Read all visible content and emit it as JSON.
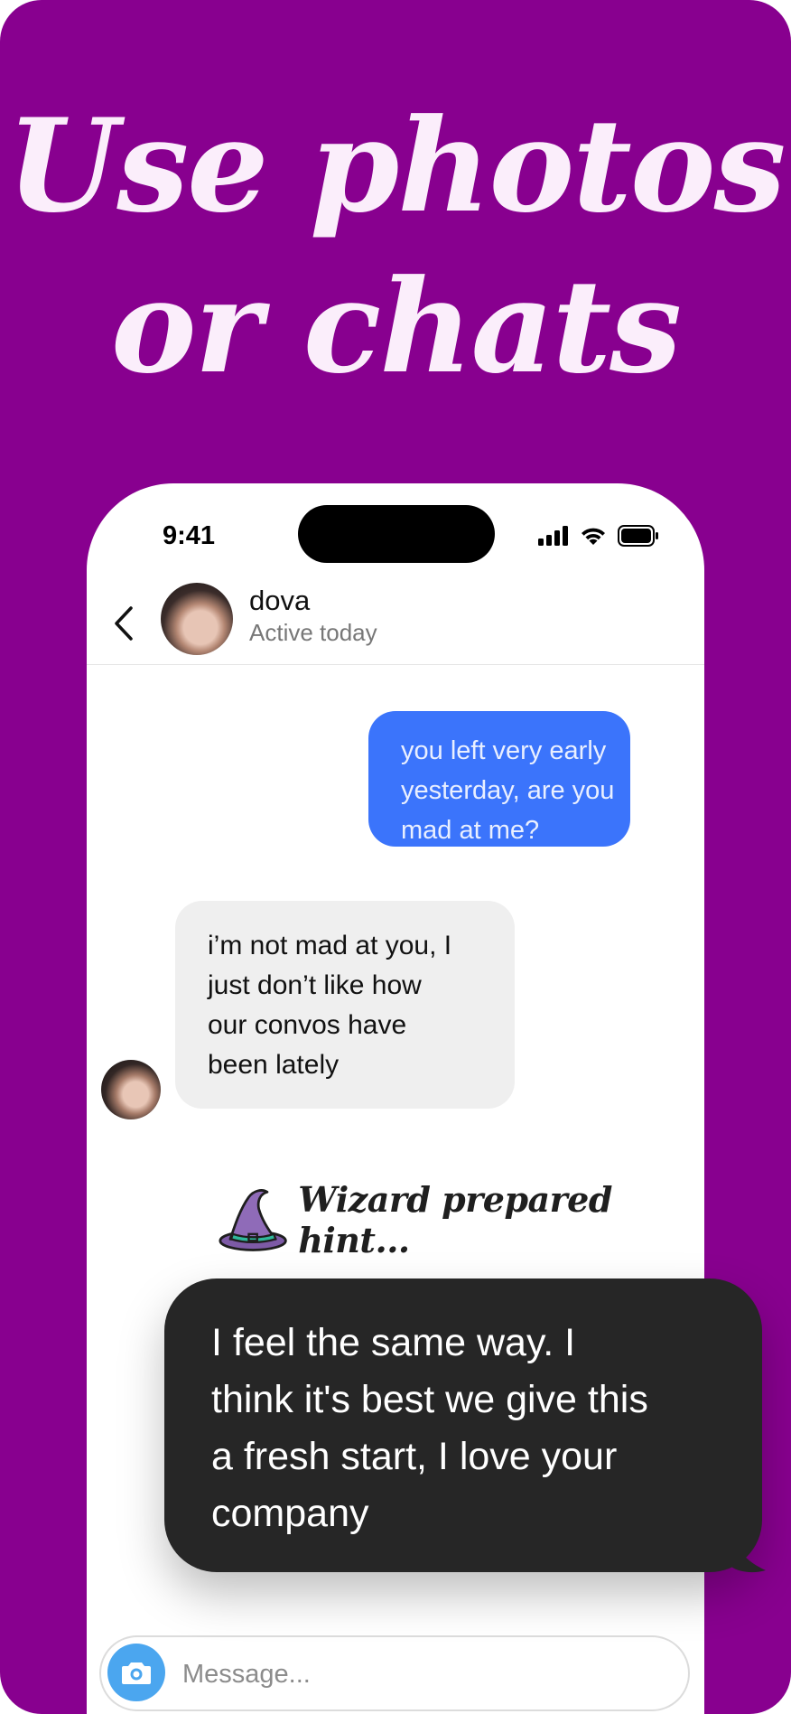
{
  "promo": {
    "headline_line1": "Use photos",
    "headline_line2": "or chats",
    "background_color": "#88008f"
  },
  "status_bar": {
    "time": "9:41",
    "icons": [
      "signal-icon",
      "wifi-icon",
      "battery-icon"
    ]
  },
  "chat_header": {
    "back_icon": "chevron-left-icon",
    "contact_name": "dova",
    "status": "Active today"
  },
  "messages": [
    {
      "direction": "outgoing",
      "line1": "you left very early",
      "line2": "yesterday, are you",
      "line3": "mad at me?",
      "color": "#3b74fb"
    },
    {
      "direction": "incoming",
      "line1": "i’m not mad at you, I",
      "line2": "just don’t like how",
      "line3": "our convos have",
      "line4": "been lately",
      "color": "#efefef"
    }
  ],
  "hint": {
    "icon": "wizard-hat-icon",
    "label": "Wizard prepared hint..."
  },
  "suggestion": {
    "line1": "I feel the same way. I",
    "line2": "think it's best we give this",
    "line3": "a fresh start, I love your",
    "line4": "company",
    "color": "#262626"
  },
  "composer": {
    "camera_icon": "camera-icon",
    "placeholder": "Message..."
  }
}
